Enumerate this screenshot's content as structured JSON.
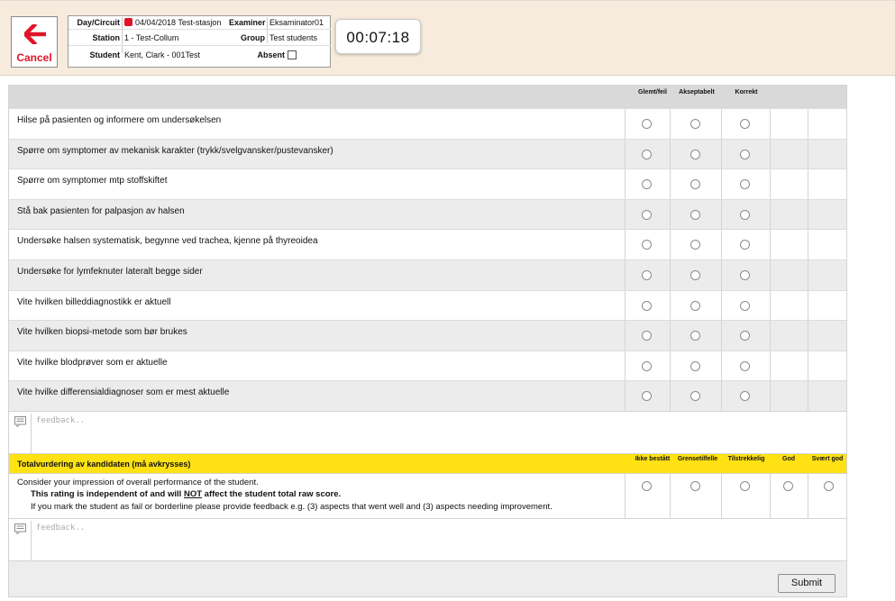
{
  "header": {
    "cancel_label": "Cancel",
    "labels": {
      "day_circuit": "Day/Circuit",
      "station": "Station",
      "student": "Student",
      "examiner": "Examiner",
      "group": "Group",
      "absent": "Absent"
    },
    "values": {
      "day_circuit": "04/04/2018 Test-stasjon",
      "station": "1 - Test-Collum",
      "student": "Kent, Clark - 001Test",
      "examiner": "Eksaminator01",
      "group": "Test students"
    },
    "absent_checked": false,
    "timer": "00:07:18"
  },
  "checklist": {
    "columns": [
      "Glemt/feil",
      "Akseptabelt",
      "Korrekt"
    ],
    "items": [
      "Hilse på pasienten og informere om undersøkelsen",
      "Spørre om symptomer av mekanisk karakter (trykk/svelgvansker/pustevansker)",
      "Spørre om symptomer mtp stoffskiftet",
      "Stå bak pasienten for palpasjon av halsen",
      "Undersøke halsen systematisk, begynne ved trachea, kjenne på thyreoidea",
      "Undersøke for lymfeknuter lateralt begge sider",
      "Vite hvilken billeddiagnostikk er aktuell",
      "Vite hvilken biopsi-metode som bør brukes",
      "Vite hvilke blodprøver som er aktuelle",
      "Vite hvilke differensialdiagnoser som er mest aktuelle"
    ],
    "feedback_placeholder": "feedback.."
  },
  "total": {
    "title": "Totalvurdering av kandidaten (må avkrysses)",
    "columns": [
      "Ikke bestått",
      "Grensetilfelle",
      "Tilstrekkelig",
      "God",
      "Svært god"
    ],
    "line1": "Consider your impression of overall performance of the student.",
    "line2_a": "This rating is independent of and will ",
    "line2_not": "NOT",
    "line2_b": " affect the student total raw score.",
    "line3": "If you mark the student as fail or borderline please provide feedback e.g. (3) aspects that went well and (3) aspects needing improvement.",
    "feedback_placeholder": "feedback.."
  },
  "submit_label": "Submit",
  "colors": {
    "header_bg": "#f6ebdc",
    "cancel_red": "#e0142a",
    "total_header_yellow": "#ffe114",
    "column_header_grey": "#d9d9d9",
    "alt_row_grey": "#ececec"
  },
  "icons": [
    "arrow-left-icon",
    "comment-icon"
  ]
}
